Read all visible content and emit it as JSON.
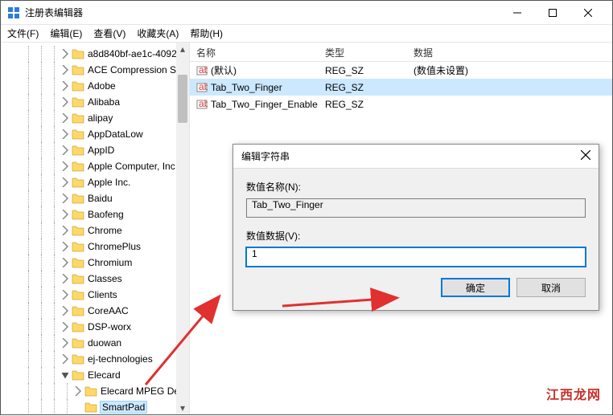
{
  "window": {
    "title": "注册表编辑器"
  },
  "menu": {
    "file": "文件(F)",
    "edit": "编辑(E)",
    "view": "查看(V)",
    "favorites": "收藏夹(A)",
    "help": "帮助(H)"
  },
  "tree": {
    "items": [
      {
        "label": "a8d840bf-ae1c-4092",
        "depth": 3,
        "chev": "right"
      },
      {
        "label": "ACE Compression So",
        "depth": 3,
        "chev": "right"
      },
      {
        "label": "Adobe",
        "depth": 3,
        "chev": "right"
      },
      {
        "label": "Alibaba",
        "depth": 3,
        "chev": "right"
      },
      {
        "label": "alipay",
        "depth": 3,
        "chev": "right"
      },
      {
        "label": "AppDataLow",
        "depth": 3,
        "chev": "right"
      },
      {
        "label": "AppID",
        "depth": 3,
        "chev": "right"
      },
      {
        "label": "Apple Computer, Inc",
        "depth": 3,
        "chev": "right"
      },
      {
        "label": "Apple Inc.",
        "depth": 3,
        "chev": "right"
      },
      {
        "label": "Baidu",
        "depth": 3,
        "chev": "right"
      },
      {
        "label": "Baofeng",
        "depth": 3,
        "chev": "right"
      },
      {
        "label": "Chrome",
        "depth": 3,
        "chev": "right"
      },
      {
        "label": "ChromePlus",
        "depth": 3,
        "chev": "right"
      },
      {
        "label": "Chromium",
        "depth": 3,
        "chev": "right"
      },
      {
        "label": "Classes",
        "depth": 3,
        "chev": "right"
      },
      {
        "label": "Clients",
        "depth": 3,
        "chev": "right"
      },
      {
        "label": "CoreAAC",
        "depth": 3,
        "chev": "right"
      },
      {
        "label": "DSP-worx",
        "depth": 3,
        "chev": "right"
      },
      {
        "label": "duowan",
        "depth": 3,
        "chev": "right"
      },
      {
        "label": "ej-technologies",
        "depth": 3,
        "chev": "right"
      },
      {
        "label": "Elecard",
        "depth": 3,
        "chev": "down"
      },
      {
        "label": "Elecard MPEG De",
        "depth": 4,
        "chev": "right"
      },
      {
        "label": "SmartPad",
        "depth": 4,
        "chev": "none",
        "selected": true
      }
    ]
  },
  "list": {
    "headers": {
      "name": "名称",
      "type": "类型",
      "data": "数据"
    },
    "rows": [
      {
        "name": "(默认)",
        "type": "REG_SZ",
        "data": "(数值未设置)",
        "icon": "default"
      },
      {
        "name": "Tab_Two_Finger",
        "type": "REG_SZ",
        "data": "",
        "icon": "string",
        "selected": true
      },
      {
        "name": "Tab_Two_Finger_Enable",
        "type": "REG_SZ",
        "data": "",
        "icon": "string"
      }
    ]
  },
  "dialog": {
    "title": "编辑字符串",
    "name_label": "数值名称(N):",
    "name_value": "Tab_Two_Finger",
    "data_label": "数值数据(V):",
    "data_value": "1",
    "ok": "确定",
    "cancel": "取消"
  },
  "watermark": "江西龙网"
}
